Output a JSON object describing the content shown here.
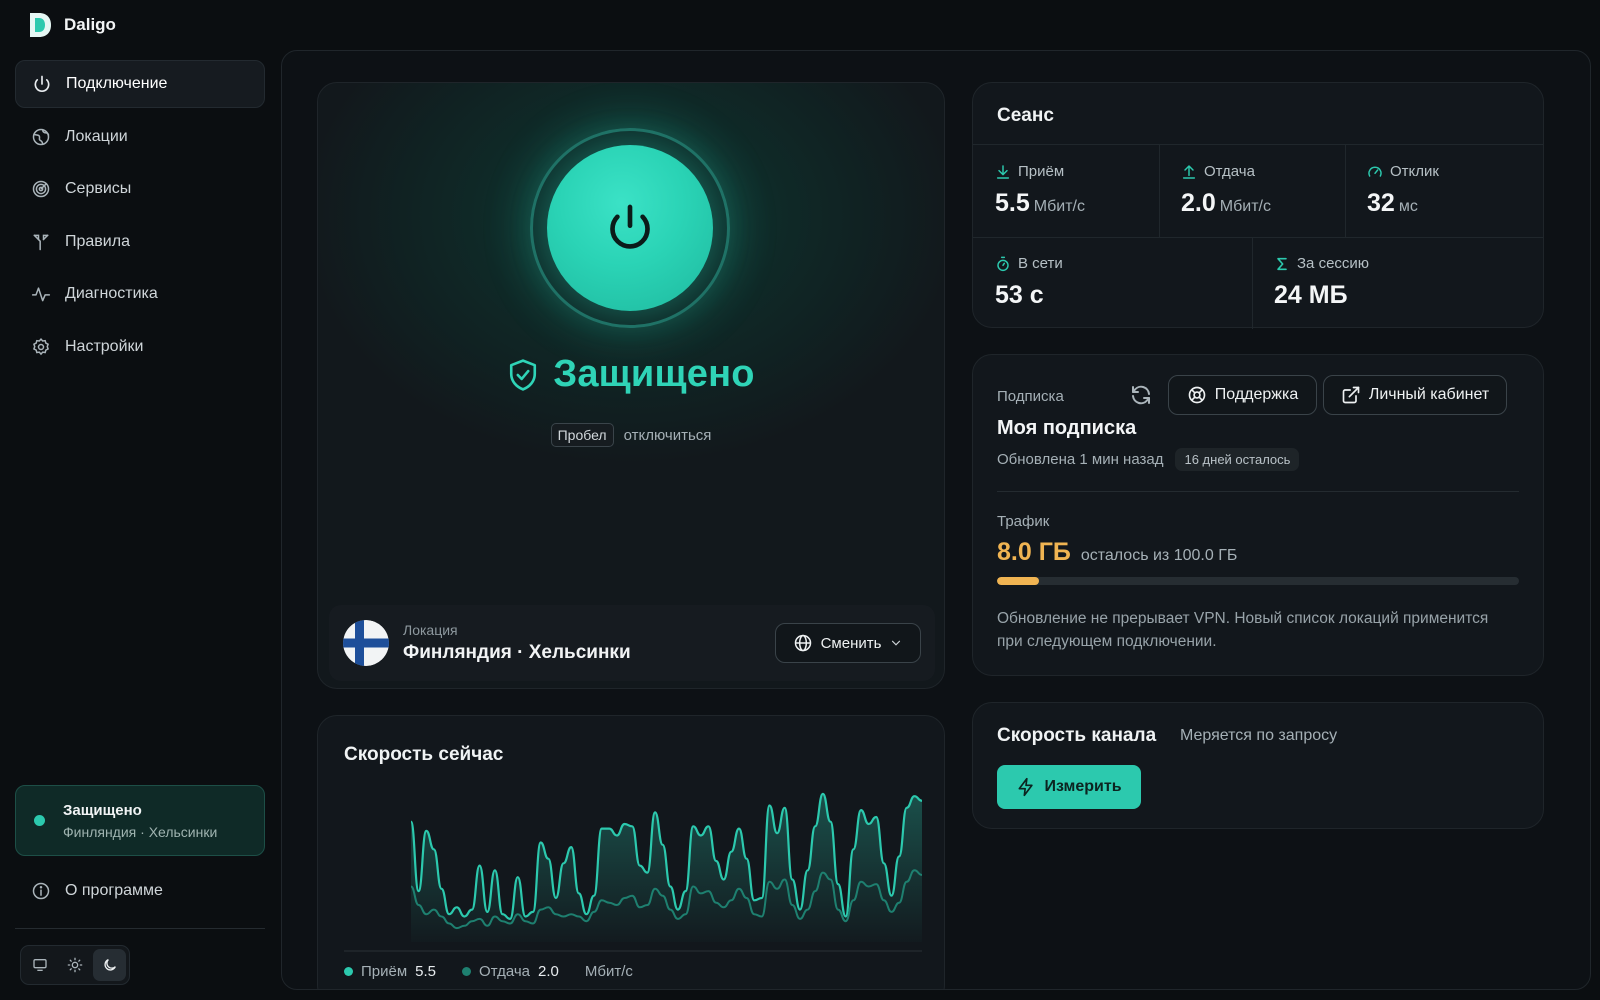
{
  "app": {
    "name": "Daligo"
  },
  "sidebar": {
    "items": [
      {
        "label": "Подключение",
        "icon": "power-icon",
        "active": true
      },
      {
        "label": "Локации",
        "icon": "globe-icon"
      },
      {
        "label": "Сервисы",
        "icon": "radar-icon"
      },
      {
        "label": "Правила",
        "icon": "split-icon"
      },
      {
        "label": "Диагностика",
        "icon": "activity-icon"
      },
      {
        "label": "Настройки",
        "icon": "gear-icon"
      }
    ],
    "status": {
      "title": "Защищено",
      "location": "Финляндия · Хельсинки"
    },
    "about": "О программе",
    "theme": {
      "selected": "dark",
      "options": [
        "system",
        "light",
        "dark"
      ]
    }
  },
  "connect": {
    "status": "Защищено",
    "hint_key": "Пробел",
    "hint_text": "отключиться",
    "location_label": "Локация",
    "location_name": "Финляндия · Хельсинки",
    "change_label": "Сменить"
  },
  "speed": {
    "title": "Скорость сейчас",
    "rx_label": "Приём",
    "rx_value": "5.5",
    "tx_label": "Отдача",
    "tx_value": "2.0",
    "unit": "Мбит/с"
  },
  "chart_data": {
    "type": "area",
    "series": [
      {
        "name": "Приём",
        "values": [
          5.2,
          2.2,
          4.8,
          4.0,
          2.3,
          1.2,
          1.5,
          1.1,
          1.4,
          3.3,
          1.3,
          3.1,
          1.2,
          1.0,
          2.8,
          1.1,
          1.3,
          4.3,
          3.6,
          1.9,
          3.4,
          4.1,
          2.1,
          1.2,
          2.0,
          4.9,
          4.9,
          4.6,
          5.1,
          5.0,
          3.3,
          3.0,
          5.6,
          4.2,
          2.4,
          1.4,
          2.2,
          5.0,
          4.6,
          5.0,
          3.5,
          2.7,
          3.9,
          4.9,
          3.6,
          1.8,
          1.9,
          5.9,
          4.7,
          5.8,
          2.7,
          1.4,
          3.1,
          5.0,
          6.4,
          5.2,
          2.5,
          1.1,
          4.0,
          5.7,
          5.1,
          5.4,
          3.4,
          2.0,
          3.7,
          5.8,
          6.3,
          6.1
        ]
      },
      {
        "name": "Отдача",
        "values": [
          2.4,
          1.6,
          1.2,
          1.4,
          1.1,
          0.8,
          0.6,
          0.7,
          0.9,
          1.0,
          0.7,
          1.1,
          0.9,
          0.8,
          1.2,
          0.9,
          0.8,
          1.4,
          1.5,
          1.2,
          1.1,
          1.2,
          1.1,
          0.9,
          1.3,
          1.8,
          1.7,
          1.6,
          1.9,
          2.0,
          1.5,
          1.6,
          2.3,
          2.0,
          1.4,
          1.0,
          1.2,
          2.4,
          2.1,
          2.2,
          1.7,
          1.5,
          1.8,
          2.3,
          1.9,
          1.2,
          1.1,
          2.6,
          2.3,
          2.7,
          1.6,
          1.0,
          1.4,
          2.2,
          3.0,
          2.7,
          1.4,
          0.9,
          1.8,
          2.6,
          2.4,
          2.5,
          1.8,
          1.3,
          1.7,
          2.6,
          3.1,
          2.9
        ]
      }
    ],
    "colors": {
      "rx": "#2cc9ae",
      "tx": "#1e8070"
    },
    "ylim": [
      0,
      7
    ],
    "grid": false
  },
  "session": {
    "title": "Сеанс",
    "rx": {
      "label": "Приём",
      "value": "5.5",
      "unit": "Мбит/с"
    },
    "tx": {
      "label": "Отдача",
      "value": "2.0",
      "unit": "Мбит/с"
    },
    "ping": {
      "label": "Отклик",
      "value": "32",
      "unit": "мс"
    },
    "online": {
      "label": "В сети",
      "value": "53 с"
    },
    "total": {
      "label": "За сессию",
      "value": "24 МБ"
    }
  },
  "subscription": {
    "label": "Подписка",
    "support": "Поддержка",
    "cabinet": "Личный кабинет",
    "name": "Моя подписка",
    "updated": "Обновлена 1 мин назад",
    "days_left": "16 дней осталось",
    "traffic_label": "Трафик",
    "traffic_value": "8.0 ГБ",
    "traffic_of": "осталось из 100.0 ГБ",
    "traffic_fraction": 0.08,
    "note": "Обновление не прерывает VPN. Новый список локаций применится при следующем подключении."
  },
  "channel": {
    "title": "Скорость канала",
    "subtitle": "Меряется по запросу",
    "measure": "Измерить"
  },
  "colors": {
    "accent": "#2cc9ae",
    "warning": "#f0b452",
    "background": "#0b0e11"
  }
}
